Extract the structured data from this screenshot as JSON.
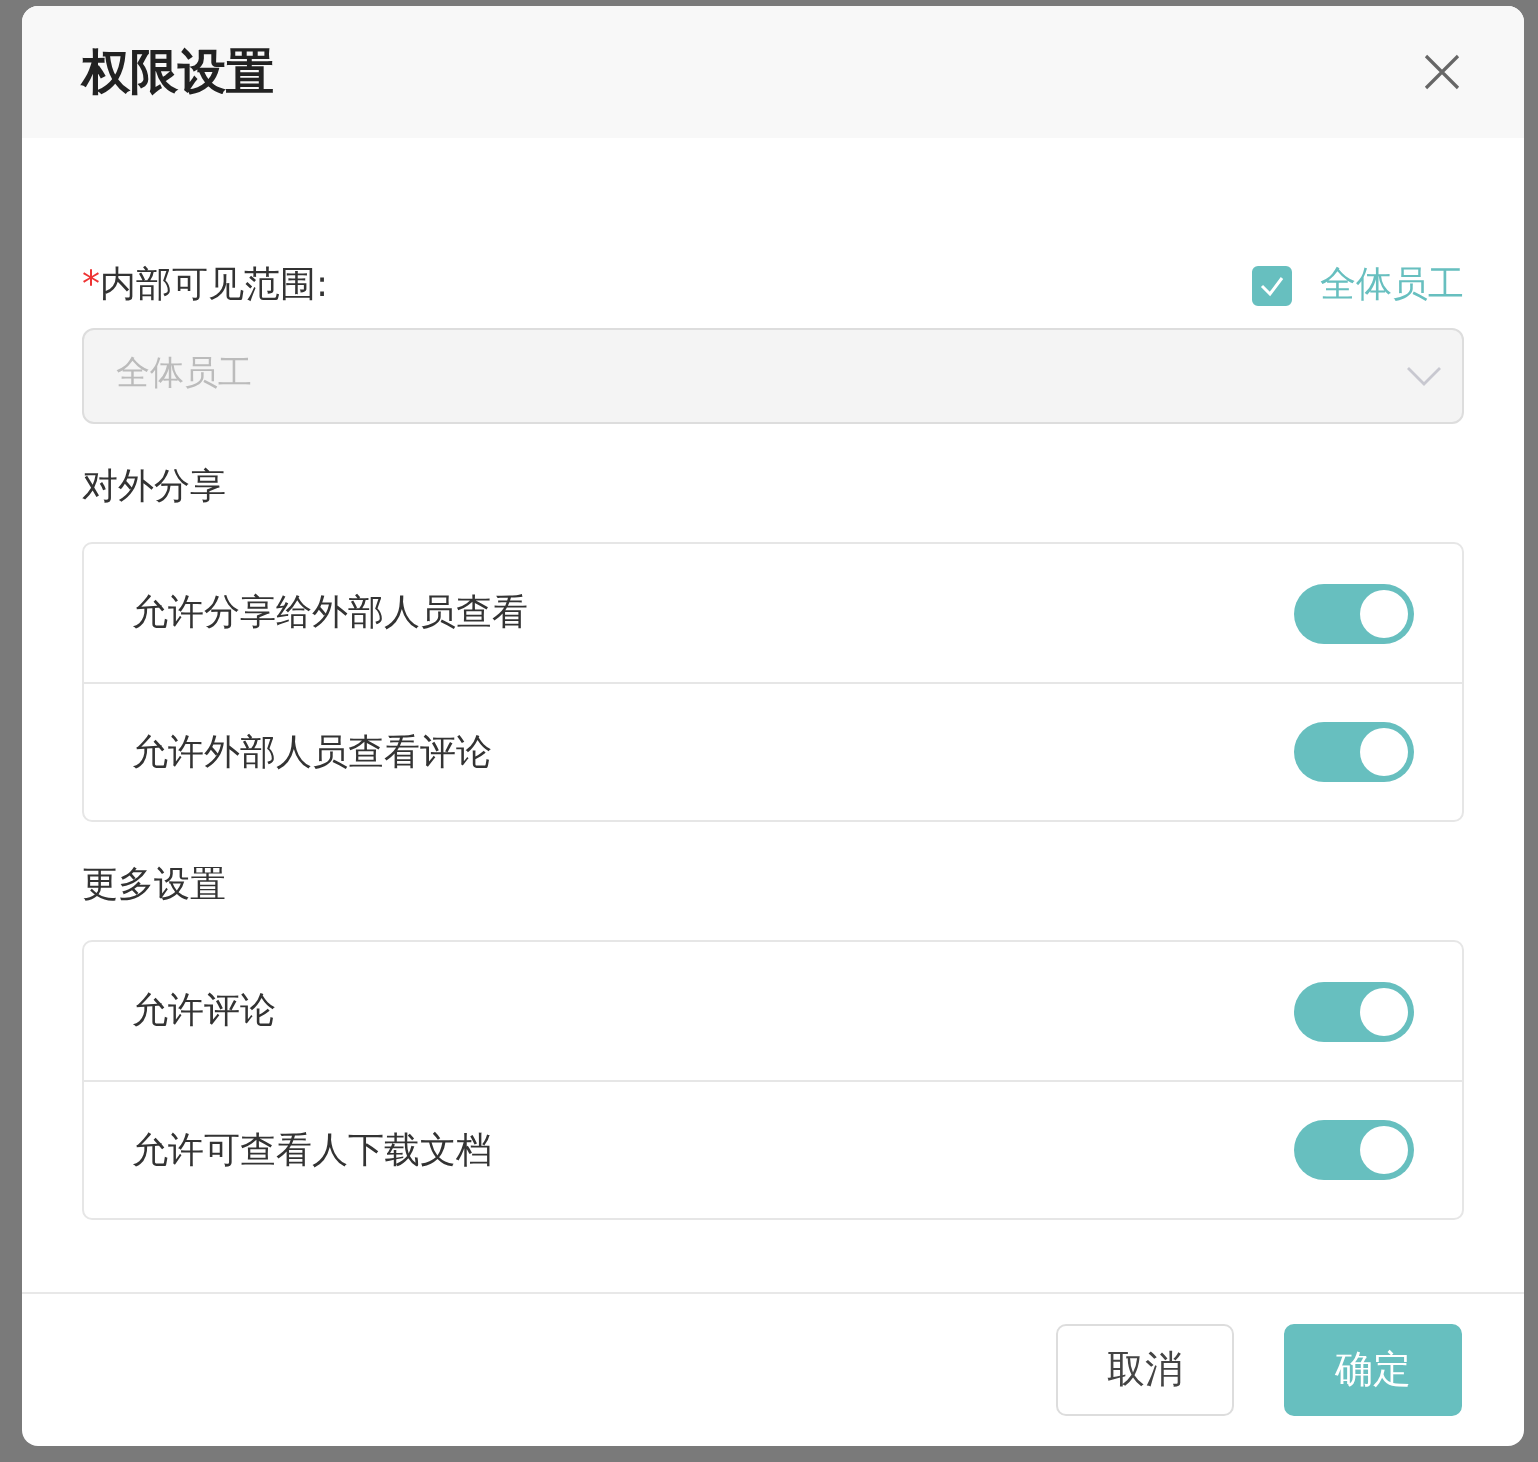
{
  "dialog": {
    "title": "权限设置"
  },
  "scope": {
    "label": "内部可见范围:",
    "required_mark": "*",
    "all_staff": {
      "label": "全体员工",
      "checked": true
    },
    "select": {
      "value": "全体员工",
      "disabled": true
    }
  },
  "sections": [
    {
      "title": "对外分享",
      "items": [
        {
          "label": "允许分享给外部人员查看",
          "on": true
        },
        {
          "label": "允许外部人员查看评论",
          "on": true
        }
      ]
    },
    {
      "title": "更多设置",
      "items": [
        {
          "label": "允许评论",
          "on": true
        },
        {
          "label": "允许可查看人下载文档",
          "on": true
        }
      ]
    }
  ],
  "buttons": [
    {
      "label": "取消",
      "kind": "secondary"
    },
    {
      "label": "确定",
      "kind": "primary"
    }
  ]
}
